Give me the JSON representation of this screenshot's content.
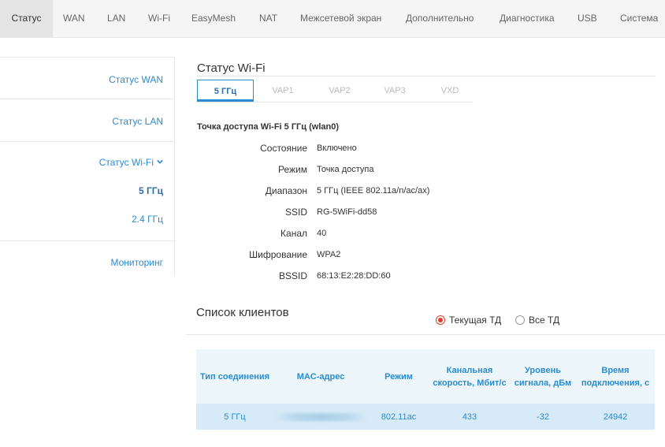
{
  "topnav": {
    "tabs": [
      "Статус",
      "WAN",
      "LAN",
      "Wi-Fi",
      "EasyMesh",
      "NAT",
      "Межсетевой экран",
      "Дополнительно",
      "Диагностика",
      "USB",
      "Система"
    ]
  },
  "sidebar": {
    "items": [
      "Статус WAN",
      "Статус LAN",
      "Статус Wi-Fi",
      "5 ГГц",
      "2.4 ГГц",
      "Мониторинг"
    ]
  },
  "wifi": {
    "title": "Статус Wi-Fi",
    "subtabs": [
      "5 ГГц",
      "VAP1",
      "VAP2",
      "VAP3",
      "VXD"
    ],
    "ap_title": "Точка доступа Wi-Fi 5 ГГц (wlan0)",
    "rows": [
      {
        "label": "Состояние",
        "value": "Включено"
      },
      {
        "label": "Режим",
        "value": "Точка доступа"
      },
      {
        "label": "Диапазон",
        "value": "5 ГГц (IEEE 802.11a/n/ac/ax)"
      },
      {
        "label": "SSID",
        "value": "RG-5WiFi-dd58"
      },
      {
        "label": "Канал",
        "value": "40"
      },
      {
        "label": "Шифрование",
        "value": "WPA2"
      },
      {
        "label": "BSSID",
        "value": "68:13:E2:28:DD:60"
      }
    ]
  },
  "clients": {
    "title": "Список клиентов",
    "radio": [
      "Текущая ТД",
      "Все ТД"
    ],
    "selected_radio": "Текущая ТД",
    "headers": [
      "Тип соединения",
      "MAC-адрес",
      "Режим",
      "Канальная скорость, Мбит/с",
      "Уровень сигнала, дБм",
      "Время подключения, с"
    ],
    "rows": [
      [
        "5 ГГц",
        "",
        "802.11ac",
        "433",
        "-32",
        "24942"
      ]
    ]
  },
  "colors": {
    "accent": "#2a8bd1",
    "radio_selected": "#e03a2f",
    "header_bg": "#edf7fb",
    "row_bg": "#d6ebf7"
  },
  "icons": {
    "expand": "chevron-down-icon"
  }
}
